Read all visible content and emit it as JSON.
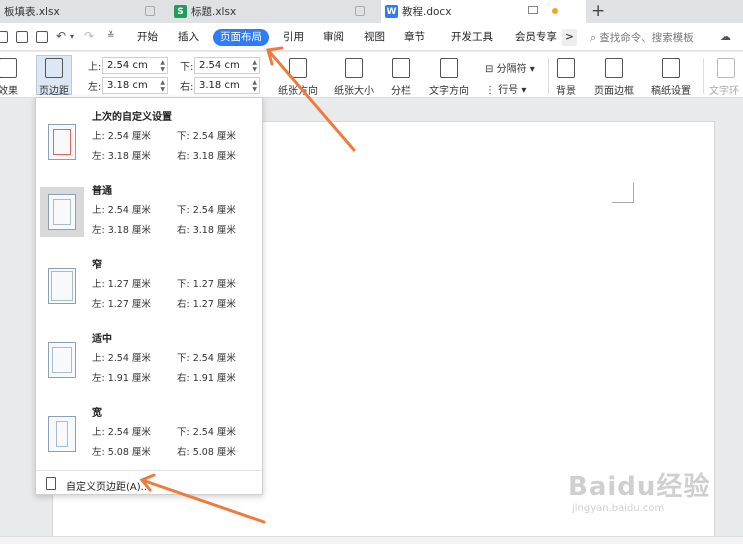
{
  "tabs": [
    {
      "label": "板填表.xlsx",
      "icon": "spreadsheet-icon",
      "color": "#1f9e5a"
    },
    {
      "label": "标题.xlsx",
      "icon": "spreadsheet-icon",
      "color": "#1f9e5a"
    },
    {
      "label": "教程.docx",
      "icon": "document-icon",
      "color": "#2e7cf6"
    }
  ],
  "menu": {
    "items": [
      "开始",
      "插入",
      "页面布局",
      "引用",
      "审阅",
      "视图",
      "章节",
      "开发工具",
      "会员专享"
    ],
    "active": "页面布局",
    "search_placeholder": "查找命令、搜索模板",
    "more": ">"
  },
  "ribbon": {
    "effects": "效果",
    "margins": "页边距",
    "margin_fields": {
      "top_label": "上:",
      "top": "2.54 cm",
      "bottom_label": "下:",
      "bottom": "2.54 cm",
      "left_label": "左:",
      "left": "3.18 cm",
      "right_label": "右:",
      "right": "3.18 cm"
    },
    "orientation": "纸张方向",
    "size": "纸张大小",
    "columns": "分栏",
    "text_direction": "文字方向",
    "separator": "分隔符",
    "line_numbers": "行号",
    "background": "背景",
    "page_border": "页面边框",
    "paper_settings": "稿纸设置",
    "text_wrap": "文字环绕"
  },
  "margin_presets": [
    {
      "name": "上次的自定义设置",
      "top": "上: 2.54 厘米",
      "bottom": "下: 2.54 厘米",
      "left": "左: 3.18 厘米",
      "right": "右: 3.18 厘米",
      "selected": false
    },
    {
      "name": "普通",
      "top": "上: 2.54 厘米",
      "bottom": "下: 2.54 厘米",
      "left": "左: 3.18 厘米",
      "right": "右: 3.18 厘米",
      "selected": true
    },
    {
      "name": "窄",
      "top": "上: 1.27 厘米",
      "bottom": "下: 1.27 厘米",
      "left": "左: 1.27 厘米",
      "right": "右: 1.27 厘米",
      "selected": false
    },
    {
      "name": "适中",
      "top": "上: 2.54 厘米",
      "bottom": "下: 2.54 厘米",
      "left": "左: 1.91 厘米",
      "right": "右: 1.91 厘米",
      "selected": false
    },
    {
      "name": "宽",
      "top": "上: 2.54 厘米",
      "bottom": "下: 2.54 厘米",
      "left": "左: 5.08 厘米",
      "right": "右: 5.08 厘米",
      "selected": false
    }
  ],
  "custom_margins": "自定义页边距(A)...",
  "watermark": {
    "logo": "Baidu经验",
    "url": "jingyan.baidu.com"
  },
  "colors": {
    "accent": "#2e7cf6",
    "arrow": "#f07a3e"
  }
}
